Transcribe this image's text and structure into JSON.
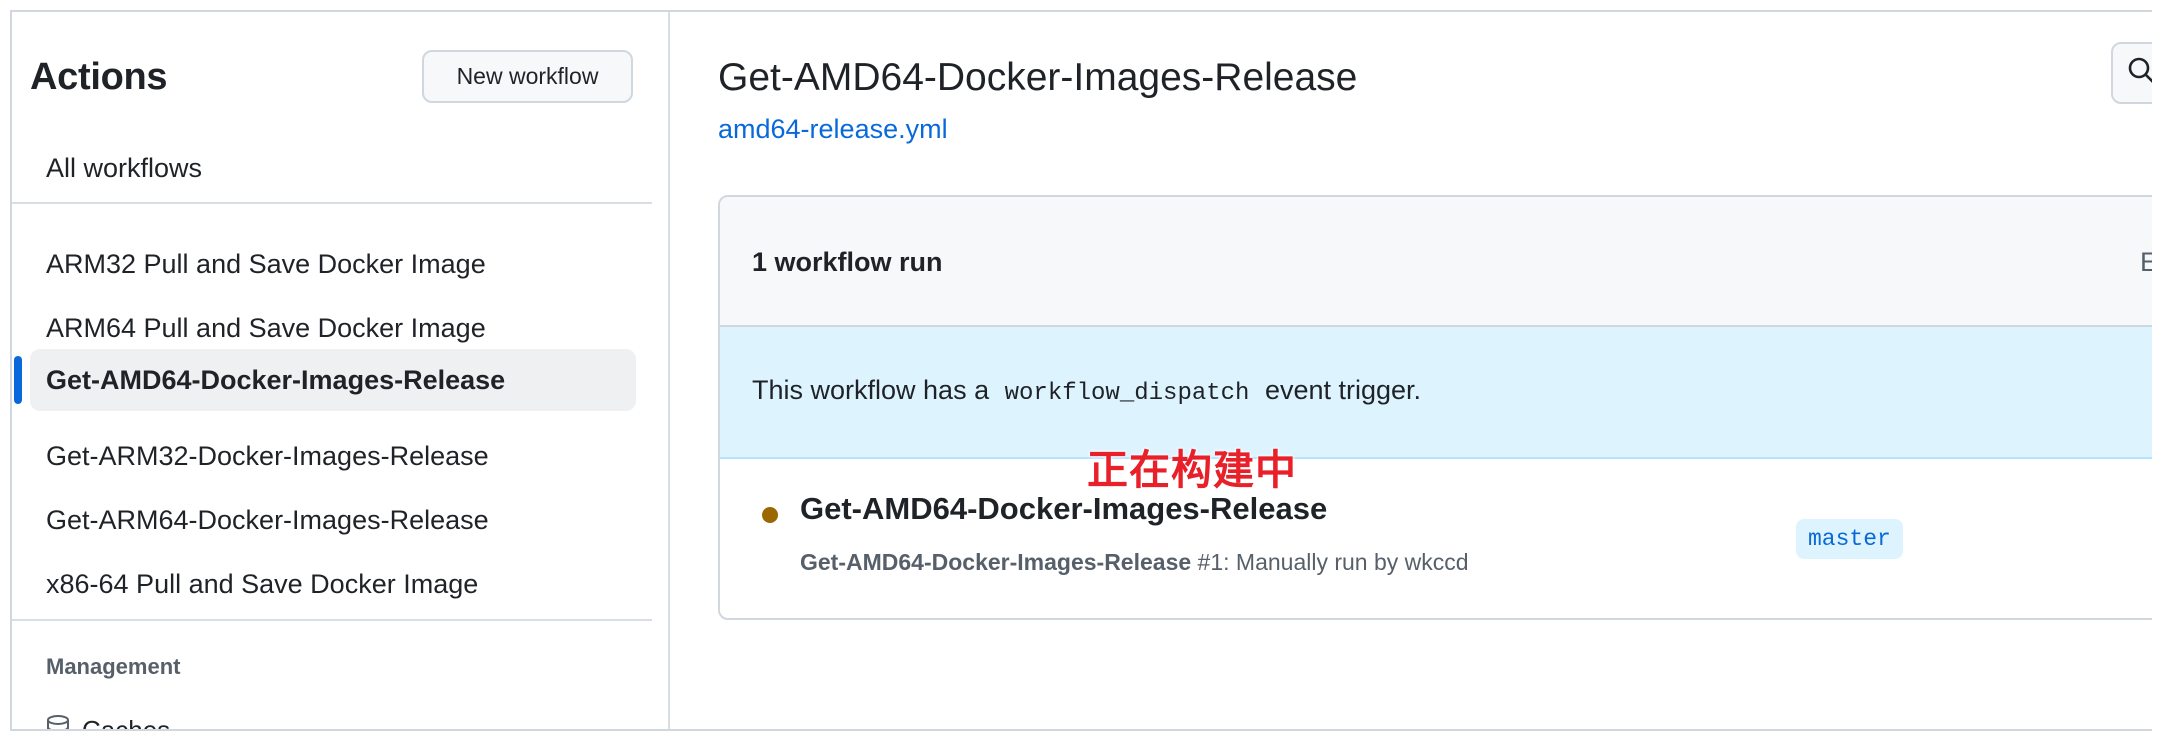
{
  "sidebar": {
    "title": "Actions",
    "new_workflow_label": "New workflow",
    "all_workflows_label": "All workflows",
    "workflows": [
      {
        "label": "ARM32 Pull and Save Docker Image"
      },
      {
        "label": "ARM64 Pull and Save Docker Image"
      },
      {
        "label": "Get-AMD64-Docker-Images-Release",
        "active": true
      },
      {
        "label": "Get-ARM32-Docker-Images-Release"
      },
      {
        "label": "Get-ARM64-Docker-Images-Release"
      },
      {
        "label": "x86-64 Pull and Save Docker Image"
      }
    ],
    "management_title": "Management",
    "caches_label": "Caches"
  },
  "main": {
    "title": "Get-AMD64-Docker-Images-Release",
    "file_link": "amd64-release.yml",
    "runs": {
      "count_label": "1 workflow run",
      "event_filter_label": "Ev",
      "banner": {
        "prefix": "This workflow has a",
        "code": "workflow_dispatch",
        "suffix": "event trigger."
      },
      "items": [
        {
          "title": "Get-AMD64-Docker-Images-Release",
          "workflow_name": "Get-AMD64-Docker-Images-Release",
          "run_number": "#1",
          "description": ": Manually run by wkccd",
          "branch": "master",
          "status": "in_progress",
          "status_color": "#9a6700"
        }
      ]
    }
  },
  "annotation": {
    "text": "正在构建中",
    "color": "#e8202a"
  },
  "colors": {
    "accent": "#0969da",
    "banner_bg": "#ddf4ff",
    "header_bg": "#f6f8fa"
  }
}
